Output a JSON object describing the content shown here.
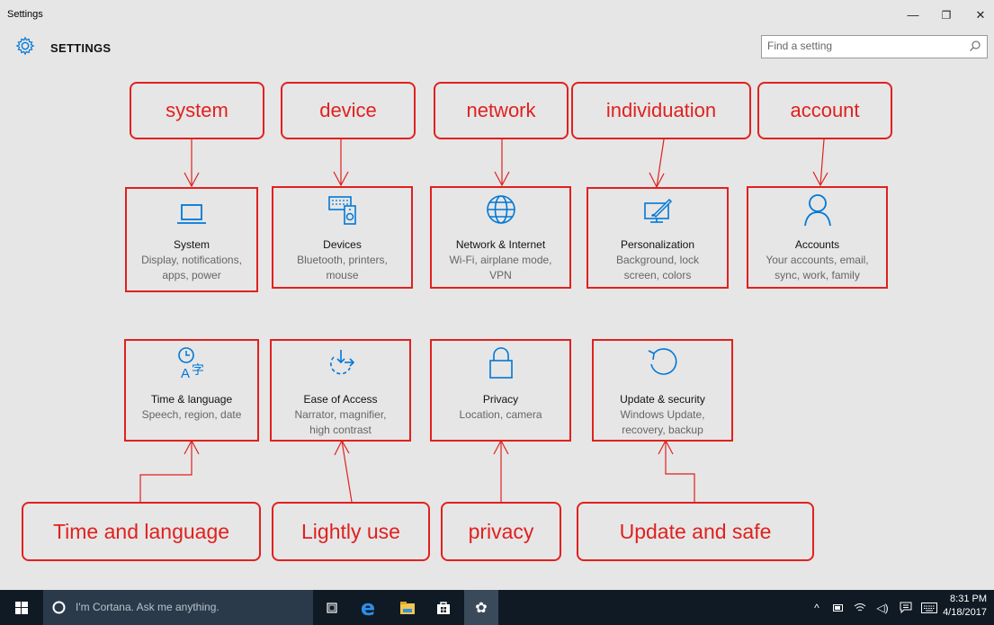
{
  "window": {
    "title": "Settings",
    "minimize": "—",
    "restore": "❐",
    "close": "✕"
  },
  "header": {
    "title": "SETTINGS",
    "icon": "gear-icon",
    "search_placeholder": "Find a setting",
    "search_icon": "search-icon"
  },
  "tiles": [
    {
      "id": "system",
      "title": "System",
      "sub1": "Display, notifications,",
      "sub2": "apps, power",
      "icon": "laptop-icon"
    },
    {
      "id": "devices",
      "title": "Devices",
      "sub1": "Bluetooth, printers,",
      "sub2": "mouse",
      "icon": "keyboard-speaker-icon"
    },
    {
      "id": "network",
      "title": "Network & Internet",
      "sub1": "Wi-Fi, airplane mode,",
      "sub2": "VPN",
      "icon": "globe-icon"
    },
    {
      "id": "personalization",
      "title": "Personalization",
      "sub1": "Background, lock",
      "sub2": "screen, colors",
      "icon": "paint-monitor-icon"
    },
    {
      "id": "accounts",
      "title": "Accounts",
      "sub1": "Your accounts, email,",
      "sub2": "sync, work, family",
      "icon": "person-icon"
    },
    {
      "id": "time",
      "title": "Time & language",
      "sub1": "Speech, region, date",
      "sub2": "",
      "icon": "time-language-icon"
    },
    {
      "id": "ease",
      "title": "Ease of Access",
      "sub1": "Narrator, magnifier,",
      "sub2": "high contrast",
      "icon": "ease-of-access-icon"
    },
    {
      "id": "privacy",
      "title": "Privacy",
      "sub1": "Location, camera",
      "sub2": "",
      "icon": "lock-icon"
    },
    {
      "id": "update",
      "title": "Update & security",
      "sub1": "Windows Update,",
      "sub2": "recovery, backup",
      "icon": "refresh-icon"
    }
  ],
  "annotations": {
    "top": [
      "system",
      "device",
      "network",
      "individuation",
      "account"
    ],
    "bottom": [
      "Time and language",
      "Lightly use",
      "privacy",
      "Update and safe"
    ]
  },
  "taskbar": {
    "cortana_placeholder": "I'm Cortana. Ask me anything.",
    "time": "8:31 PM",
    "date": "4/18/2017",
    "pinned": [
      "task-view-icon",
      "edge-icon",
      "file-explorer-icon",
      "store-icon",
      "settings-icon"
    ],
    "tray": [
      "chevron-up-icon",
      "battery-icon",
      "wifi-icon",
      "volume-icon",
      "action-center-icon",
      "keyboard-icon"
    ]
  },
  "colors": {
    "accent": "#0078d7",
    "annotation": "#e0211f",
    "background": "#e6e6e6",
    "taskbar": "#0f1a24"
  }
}
